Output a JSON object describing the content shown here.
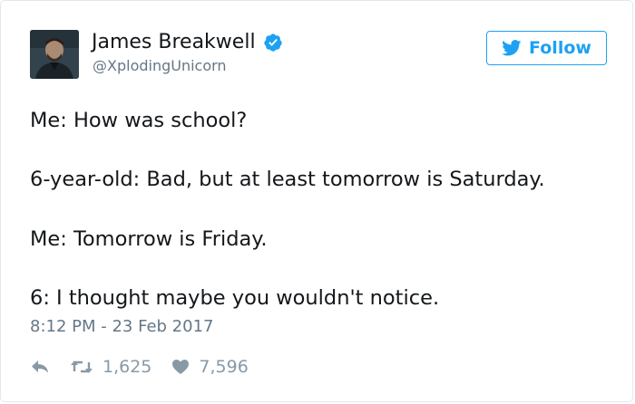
{
  "author": {
    "name": "James Breakwell",
    "handle": "@XplodingUnicorn",
    "verified": true
  },
  "follow_button": {
    "label": "Follow"
  },
  "tweet": {
    "lines": [
      "Me: How was school?",
      "6-year-old: Bad, but at least tomorrow is Saturday.",
      "Me: Tomorrow is Friday.",
      "6: I thought maybe you wouldn't notice."
    ],
    "timestamp": "8:12 PM - 23 Feb 2017"
  },
  "actions": {
    "reply_icon": "reply-icon",
    "retweet_icon": "retweet-icon",
    "retweet_count": "1,625",
    "like_icon": "heart-icon",
    "like_count": "7,596"
  },
  "colors": {
    "accent": "#1da1f2",
    "text": "#14171a",
    "muted": "#657786",
    "action": "#8899a6",
    "border": "#e1e8ed"
  }
}
